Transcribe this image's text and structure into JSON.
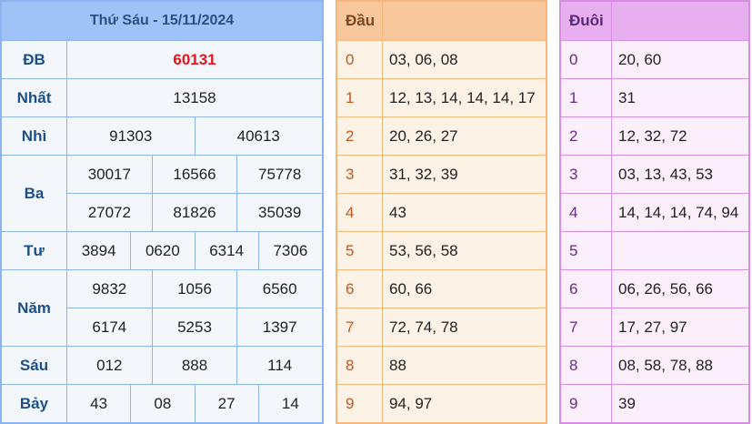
{
  "header": {
    "title": "Thứ Sáu - 15/11/2024"
  },
  "prizes": {
    "db": {
      "label": "ĐB",
      "values": [
        "60131"
      ]
    },
    "nhat": {
      "label": "Nhất",
      "values": [
        "13158"
      ]
    },
    "nhi": {
      "label": "Nhì",
      "values": [
        "91303",
        "40613"
      ]
    },
    "ba": {
      "label": "Ba",
      "values": [
        "30017",
        "16566",
        "75778",
        "27072",
        "81826",
        "35039"
      ]
    },
    "tu": {
      "label": "Tư",
      "values": [
        "3894",
        "0620",
        "6314",
        "7306"
      ]
    },
    "nam": {
      "label": "Năm",
      "values": [
        "9832",
        "1056",
        "6560",
        "6174",
        "5253",
        "1397"
      ]
    },
    "sau": {
      "label": "Sáu",
      "values": [
        "012",
        "888",
        "114"
      ]
    },
    "bay": {
      "label": "Bảy",
      "values": [
        "43",
        "08",
        "27",
        "14"
      ]
    }
  },
  "dau": {
    "title": "Đầu",
    "rows": [
      {
        "key": "0",
        "val": "03, 06, 08"
      },
      {
        "key": "1",
        "val": "12, 13, 14, 14, 14, 17"
      },
      {
        "key": "2",
        "val": "20, 26, 27"
      },
      {
        "key": "3",
        "val": "31, 32, 39"
      },
      {
        "key": "4",
        "val": "43"
      },
      {
        "key": "5",
        "val": "53, 56, 58"
      },
      {
        "key": "6",
        "val": "60, 66"
      },
      {
        "key": "7",
        "val": "72, 74, 78"
      },
      {
        "key": "8",
        "val": "88"
      },
      {
        "key": "9",
        "val": "94, 97"
      }
    ]
  },
  "duoi": {
    "title": "Đuôi",
    "rows": [
      {
        "key": "0",
        "val": "20, 60"
      },
      {
        "key": "1",
        "val": "31"
      },
      {
        "key": "2",
        "val": "12, 32, 72"
      },
      {
        "key": "3",
        "val": "03, 13, 43, 53"
      },
      {
        "key": "4",
        "val": "14, 14, 14, 74, 94"
      },
      {
        "key": "5",
        "val": ""
      },
      {
        "key": "6",
        "val": "06, 26, 56, 66"
      },
      {
        "key": "7",
        "val": "17, 27, 97"
      },
      {
        "key": "8",
        "val": "08, 58, 78, 88"
      },
      {
        "key": "9",
        "val": "39"
      }
    ]
  },
  "colors": {
    "special_prize": "#e8141b",
    "main_accent": "#9fc2f7",
    "dau_accent": "#f8c89c",
    "duoi_accent": "#e7aef0"
  }
}
